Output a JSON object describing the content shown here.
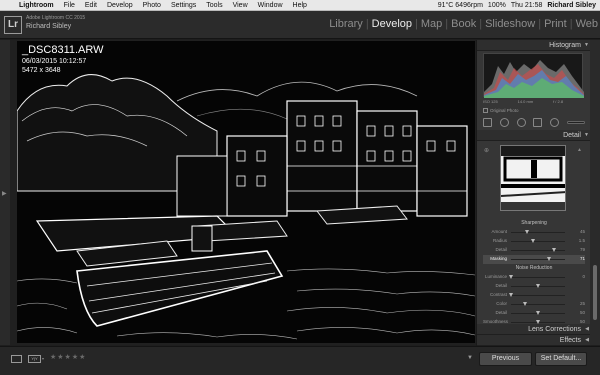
{
  "menubar": {
    "apple_icon": "",
    "items": [
      "Lightroom",
      "File",
      "Edit",
      "Develop",
      "Photo",
      "Settings",
      "Tools",
      "View",
      "Window",
      "Help"
    ],
    "status": {
      "temp": "91°C 6496rpm",
      "battery": "100%",
      "day_time": "Thu 21:58",
      "user": "Richard Sibley"
    }
  },
  "app": {
    "logo": "Lr",
    "product": "Adobe Lightroom CC 2015",
    "user": "Richard Sibley",
    "modules": [
      "Library",
      "Develop",
      "Map",
      "Book",
      "Slideshow",
      "Print",
      "Web"
    ],
    "active_module": "Develop"
  },
  "photo": {
    "filename": "_DSC8311.ARW",
    "datetime": "06/03/2015 10:12:57",
    "dimensions": "5472 x 3648"
  },
  "panels": {
    "histogram": {
      "title": "Histogram",
      "exif": [
        "ISO 125",
        "14.0 mm",
        "f / 2.8",
        ""
      ],
      "original_photo": "Original Photo"
    },
    "detail": {
      "title": "Detail",
      "sharpening": {
        "title": "Sharpening",
        "rows": [
          {
            "label": "Amount",
            "value": "45",
            "level": 0.3
          },
          {
            "label": "Radius",
            "value": "1.5",
            "level": 0.4
          },
          {
            "label": "Detail",
            "value": "79",
            "level": 0.79
          },
          {
            "label": "Masking",
            "value": "71",
            "level": 0.71,
            "active": true
          }
        ]
      },
      "noise_reduction": {
        "title": "Noise Reduction",
        "rows": [
          {
            "label": "Luminance",
            "value": "0",
            "level": 0.0
          },
          {
            "label": "Detail",
            "value": "",
            "level": 0.5
          },
          {
            "label": "Contrast",
            "value": "",
            "level": 0.0
          },
          {
            "label": "Color",
            "value": "25",
            "level": 0.25
          },
          {
            "label": "Detail",
            "value": "50",
            "level": 0.5
          },
          {
            "label": "Smoothness",
            "value": "50",
            "level": 0.5
          }
        ]
      }
    },
    "lens_corrections": {
      "title": "Lens Corrections"
    },
    "effects": {
      "title": "Effects"
    }
  },
  "footer": {
    "previous": "Previous",
    "set_default": "Set Default...",
    "rating": "★★★★★",
    "view_icon": "loupe-view-icon",
    "compare_icon": "before-after-icon"
  }
}
